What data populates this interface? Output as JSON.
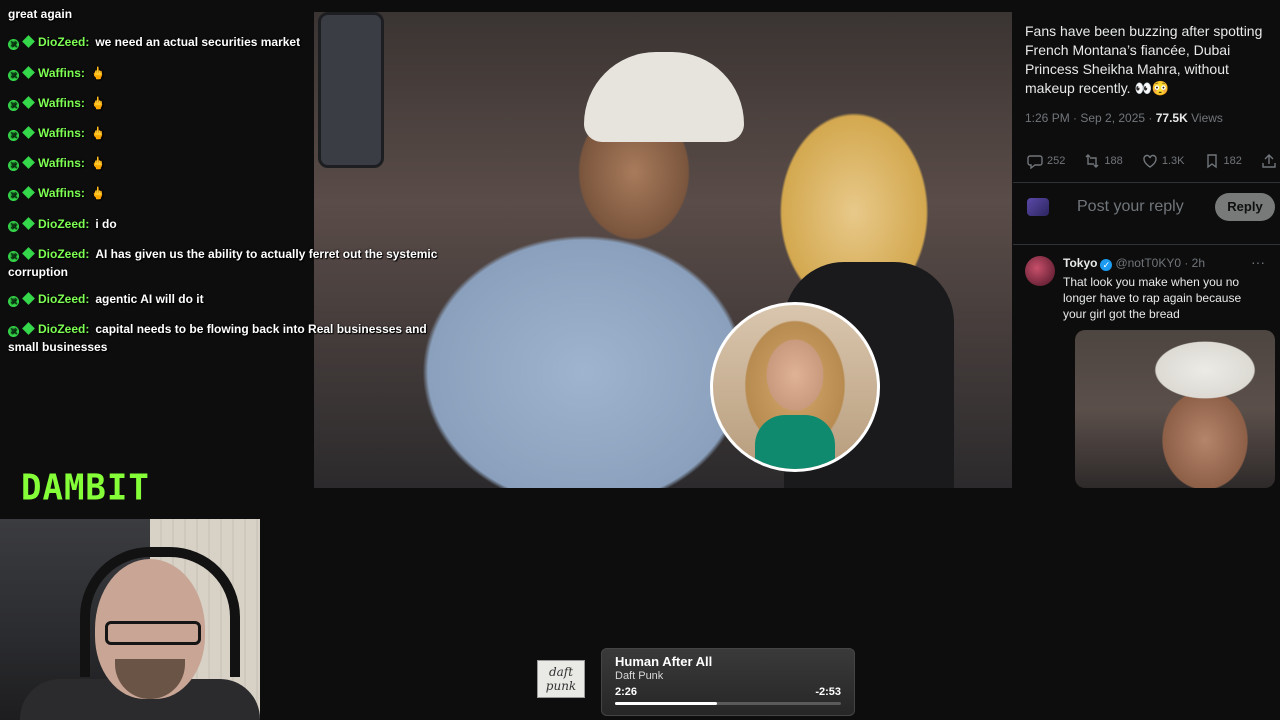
{
  "chat": {
    "lines": [
      {
        "user": "",
        "text": "great again"
      },
      {
        "user": "DioZeed:",
        "text": "we need an actual securities market"
      },
      {
        "user": "Waffins:",
        "text": "🖕"
      },
      {
        "user": "Waffins:",
        "text": "🖕"
      },
      {
        "user": "Waffins:",
        "text": "🖕"
      },
      {
        "user": "Waffins:",
        "text": "🖕"
      },
      {
        "user": "Waffins:",
        "text": "🖕"
      },
      {
        "user": "DioZeed:",
        "text": "i do"
      },
      {
        "user": "DioZeed:",
        "text": "AI has given us the ability to actually ferret out the systemic corruption"
      },
      {
        "user": "DioZeed:",
        "text": "agentic AI will do it"
      },
      {
        "user": "DioZeed:",
        "text": "capital needs to be flowing back into Real businesses and small businesses"
      }
    ]
  },
  "logo": {
    "text": "DAMBIT"
  },
  "tweet": {
    "text": "Fans have been buzzing after spotting French Montana’s fiancée, Dubai Princess Sheikha Mahra, without makeup recently. 👀😳",
    "time": "1:26 PM · Sep 2, 2025 · ",
    "views": "77.5K",
    "views_label": " Views",
    "replies": "252",
    "reposts": "188",
    "likes": "1.3K",
    "bookmarks": "182",
    "reply_placeholder": "Post your reply",
    "reply_button": "Reply"
  },
  "comment": {
    "name": "Tokyo",
    "handle": "@notT0KY0 · 2h",
    "more": "···",
    "text": "That look you make when you no longer have to rap again because your girl got the bread"
  },
  "player": {
    "album_text": "daft punk",
    "title": "Human After All",
    "artist": "Daft Punk",
    "elapsed": "2:26",
    "remaining": "-2:53",
    "progress": 0.45
  },
  "colors": {
    "chat_username": "#7dff53",
    "badge": "#36d84b",
    "logo": "#84ff38",
    "verified": "#1d9bf0"
  }
}
